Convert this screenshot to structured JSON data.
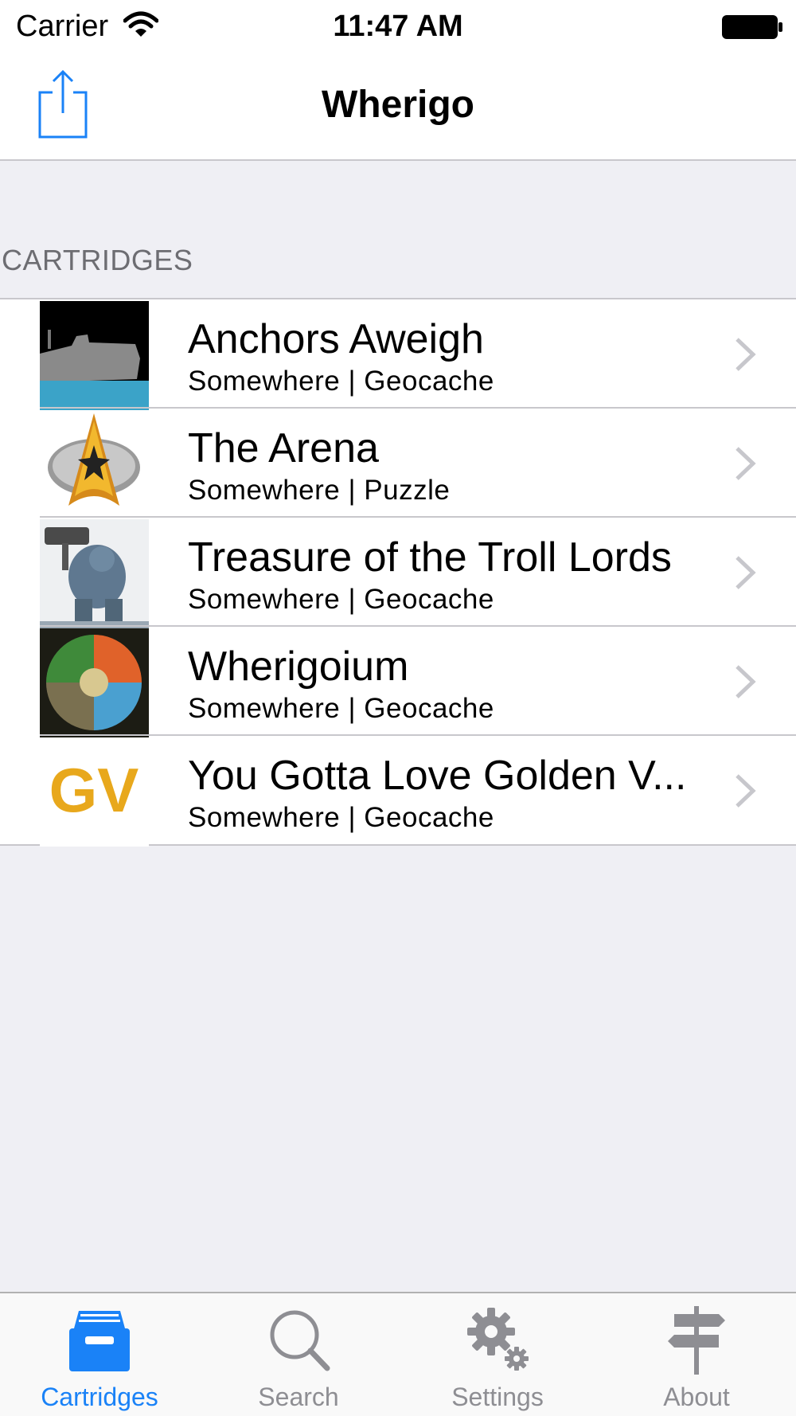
{
  "status_bar": {
    "carrier": "Carrier",
    "time": "11:47 AM"
  },
  "nav": {
    "title": "Wherigo",
    "share_icon": "share-icon"
  },
  "section": {
    "header": "CARTRIDGES"
  },
  "cartridges": [
    {
      "title": "Anchors Aweigh",
      "subtitle": "Somewhere | Geocache",
      "thumbnail": "ship-thumbnail"
    },
    {
      "title": "The Arena",
      "subtitle": "Somewhere | Puzzle",
      "thumbnail": "starfleet-insignia-thumbnail"
    },
    {
      "title": "Treasure of the Troll Lords",
      "subtitle": "Somewhere | Geocache",
      "thumbnail": "troll-thumbnail"
    },
    {
      "title": "Wherigoium",
      "subtitle": "Somewhere | Geocache",
      "thumbnail": "elements-thumbnail"
    },
    {
      "title": "You Gotta Love Golden V...",
      "subtitle": "Somewhere | Geocache",
      "thumbnail": "gv-logo-thumbnail",
      "thumb_text": "GV"
    }
  ],
  "tabs": [
    {
      "label": "Cartridges",
      "icon": "cartridge-drawer-icon",
      "active": true
    },
    {
      "label": "Search",
      "icon": "search-icon",
      "active": false
    },
    {
      "label": "Settings",
      "icon": "gear-icon",
      "active": false
    },
    {
      "label": "About",
      "icon": "signpost-icon",
      "active": false
    }
  ],
  "colors": {
    "accent": "#1a82f7",
    "background": "#efeff4",
    "separator": "#c8c7cc",
    "inactive": "#8e8e93",
    "gv_gold": "#e8a81c"
  }
}
